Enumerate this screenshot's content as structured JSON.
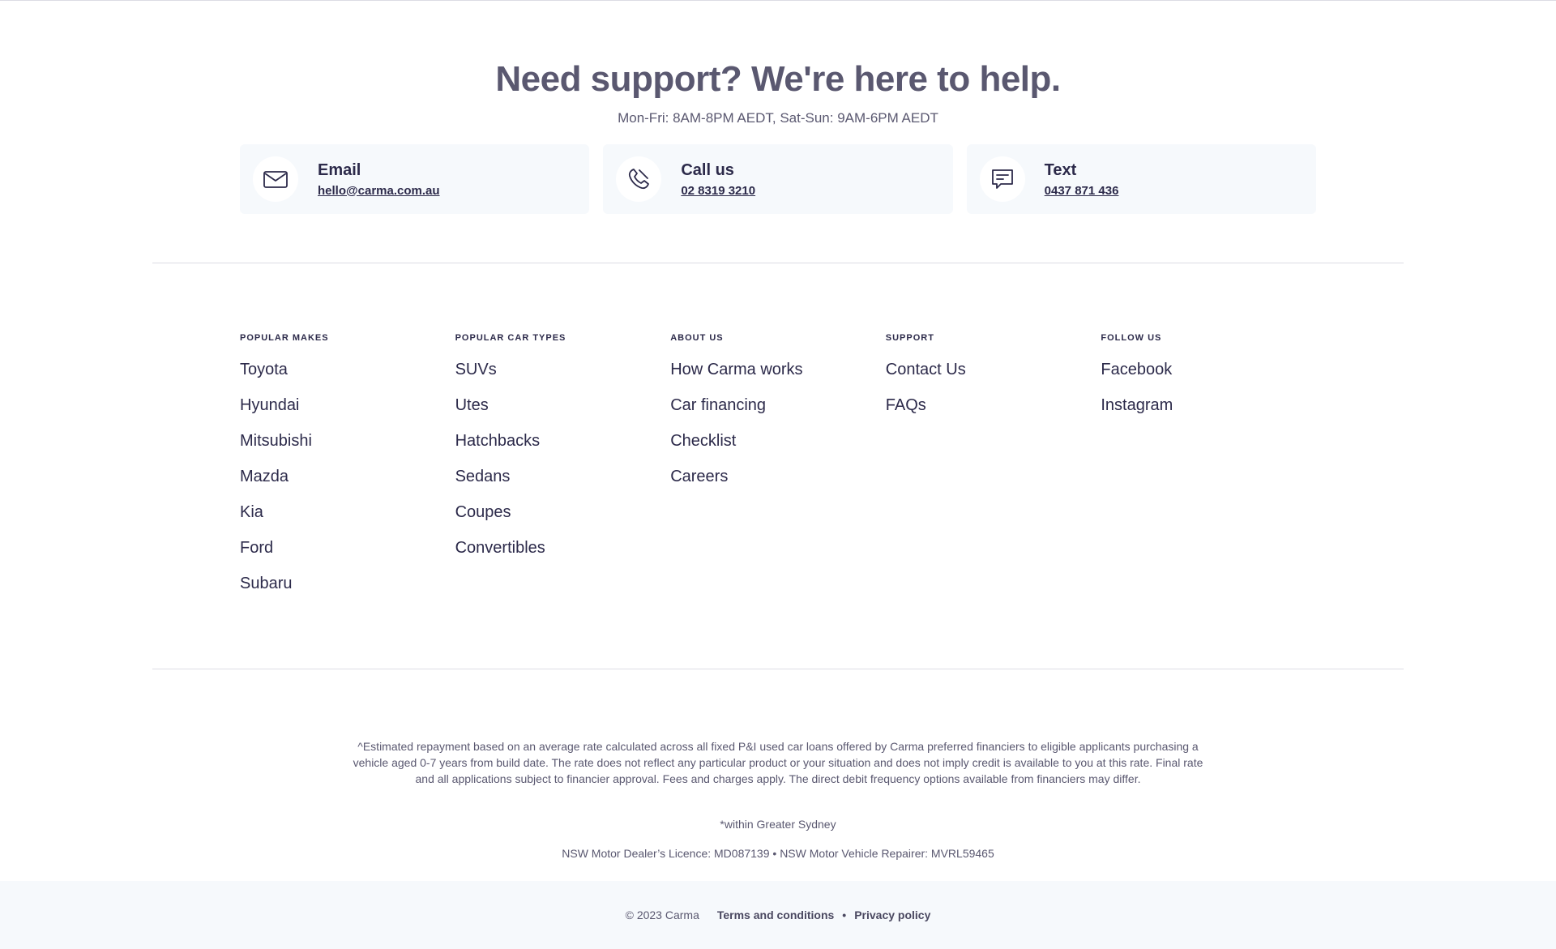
{
  "support": {
    "heading": "Need support? We're here to help.",
    "hours": "Mon-Fri: 8AM-8PM AEDT, Sat-Sun: 9AM-6PM AEDT",
    "cards": [
      {
        "label": "Email",
        "value": "hello@carma.com.au",
        "icon": "envelope-icon"
      },
      {
        "label": "Call us",
        "value": "02 8319 3210",
        "icon": "phone-icon"
      },
      {
        "label": "Text",
        "value": "0437 871 436",
        "icon": "message-icon"
      }
    ]
  },
  "footer": {
    "columns": [
      {
        "heading": "POPULAR MAKES",
        "items": [
          "Toyota",
          "Hyundai",
          "Mitsubishi",
          "Mazda",
          "Kia",
          "Ford",
          "Subaru"
        ]
      },
      {
        "heading": "POPULAR CAR TYPES",
        "items": [
          "SUVs",
          "Utes",
          "Hatchbacks",
          "Sedans",
          "Coupes",
          "Convertibles"
        ]
      },
      {
        "heading": "ABOUT US",
        "items": [
          "How Carma works",
          "Car financing",
          "Checklist",
          "Careers"
        ]
      },
      {
        "heading": "SUPPORT",
        "items": [
          "Contact Us",
          "FAQs"
        ]
      },
      {
        "heading": "FOLLOW US",
        "items": [
          "Facebook",
          "Instagram"
        ]
      }
    ]
  },
  "legal": {
    "disclaimer": "^Estimated repayment based on an average rate calculated across all fixed P&I used car loans offered by Carma preferred financiers to eligible applicants purchasing a vehicle aged 0-7 years from build date. The rate does not reflect any particular product or your situation and does not imply credit is available to you at this rate. Final rate and all applications subject to financier approval. Fees and charges apply. The direct debit frequency options available from financiers may differ.",
    "region_note": "*within Greater Sydney",
    "licence": "NSW Motor Dealer’s Licence: MD087139 • NSW Motor Vehicle Repairer: MVRL59465"
  },
  "bottom": {
    "copyright": "© 2023 Carma",
    "terms": "Terms and conditions",
    "separator": "•",
    "privacy": "Privacy policy"
  }
}
